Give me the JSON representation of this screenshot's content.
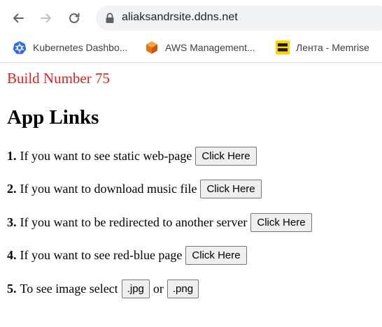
{
  "browser": {
    "url": "aliaksandrsite.ddns.net",
    "bookmarks": [
      {
        "label": "Kubernetes Dashbo...",
        "icon": "kubernetes-icon"
      },
      {
        "label": "AWS Management...",
        "icon": "aws-cube-icon"
      },
      {
        "label": "Лента - Memrise",
        "icon": "memrise-icon"
      }
    ]
  },
  "page": {
    "build_label": "Build Number 75",
    "heading": "App Links",
    "items": [
      {
        "number": "1.",
        "text": "If you want to see static web-page",
        "button": "Click Here"
      },
      {
        "number": "2.",
        "text": "If you want to download music file",
        "button": "Click Here"
      },
      {
        "number": "3.",
        "text": "If you want to be redirected to another server",
        "button": "Click Here"
      },
      {
        "number": "4.",
        "text": "If you want to see red-blue page",
        "button": "Click Here"
      },
      {
        "number": "5.",
        "text": "To see image select",
        "button_jpg": ".jpg",
        "or": "or",
        "button_png": ".png"
      }
    ]
  },
  "colors": {
    "build_label": "#e0211e",
    "omnibox_bg": "#f1f3f4",
    "button_bg": "#efefef",
    "button_border": "#767676"
  }
}
